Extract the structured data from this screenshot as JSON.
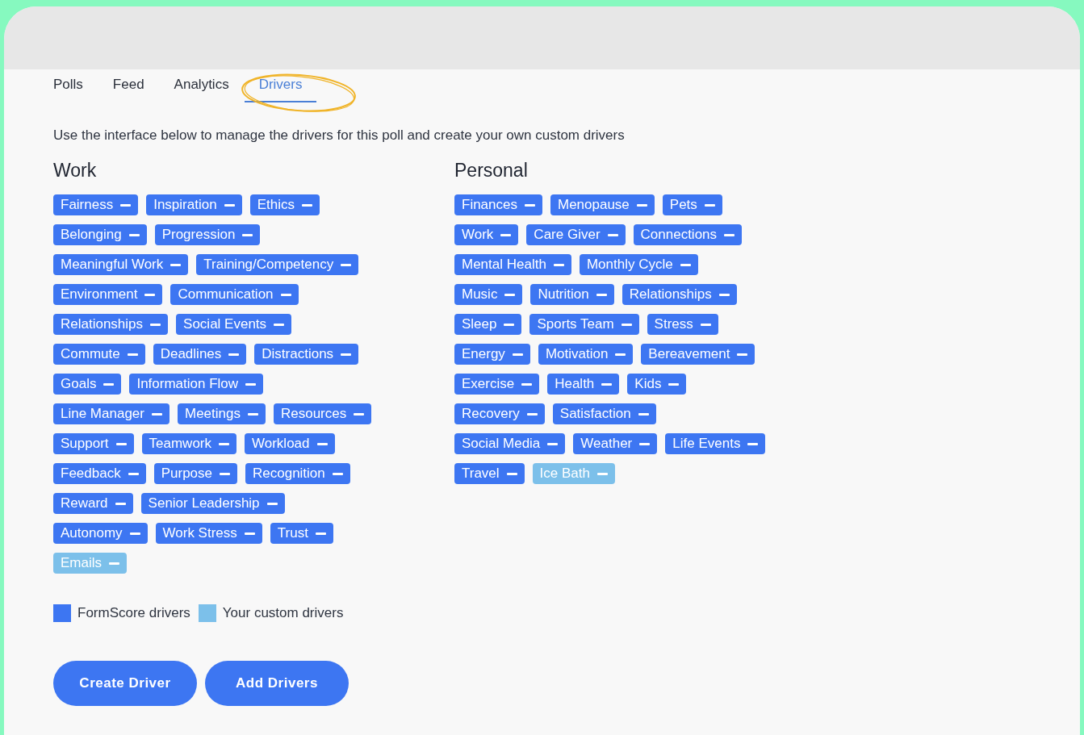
{
  "tabs": [
    {
      "label": "Polls",
      "selected": false,
      "circled": false
    },
    {
      "label": "Feed",
      "selected": false,
      "circled": false
    },
    {
      "label": "Analytics",
      "selected": false,
      "circled": false
    },
    {
      "label": "Drivers",
      "selected": true,
      "circled": true
    }
  ],
  "intro": "Use the interface below to manage the drivers for this poll and create your own custom drivers",
  "groups": [
    {
      "title": "Work",
      "rows": [
        [
          {
            "label": "Fairness",
            "kind": "formscore"
          },
          {
            "label": "Inspiration",
            "kind": "formscore"
          },
          {
            "label": "Ethics",
            "kind": "formscore"
          }
        ],
        [
          {
            "label": "Belonging",
            "kind": "formscore"
          },
          {
            "label": "Progression",
            "kind": "formscore"
          }
        ],
        [
          {
            "label": "Meaningful Work",
            "kind": "formscore"
          },
          {
            "label": "Training/Competency",
            "kind": "formscore"
          }
        ],
        [
          {
            "label": "Environment",
            "kind": "formscore"
          },
          {
            "label": "Communication",
            "kind": "formscore"
          }
        ],
        [
          {
            "label": "Relationships",
            "kind": "formscore"
          },
          {
            "label": "Social Events",
            "kind": "formscore"
          }
        ],
        [
          {
            "label": "Commute",
            "kind": "formscore"
          },
          {
            "label": "Deadlines",
            "kind": "formscore"
          },
          {
            "label": "Distractions",
            "kind": "formscore"
          }
        ],
        [
          {
            "label": "Goals",
            "kind": "formscore"
          },
          {
            "label": "Information Flow",
            "kind": "formscore"
          }
        ],
        [
          {
            "label": "Line Manager",
            "kind": "formscore"
          },
          {
            "label": "Meetings",
            "kind": "formscore"
          },
          {
            "label": "Resources",
            "kind": "formscore"
          }
        ],
        [
          {
            "label": "Support",
            "kind": "formscore"
          },
          {
            "label": "Teamwork",
            "kind": "formscore"
          },
          {
            "label": "Workload",
            "kind": "formscore"
          }
        ],
        [
          {
            "label": "Feedback",
            "kind": "formscore"
          },
          {
            "label": "Purpose",
            "kind": "formscore"
          },
          {
            "label": "Recognition",
            "kind": "formscore"
          }
        ],
        [
          {
            "label": "Reward",
            "kind": "formscore"
          },
          {
            "label": "Senior Leadership",
            "kind": "formscore"
          }
        ],
        [
          {
            "label": "Autonomy",
            "kind": "formscore"
          },
          {
            "label": "Work Stress",
            "kind": "formscore"
          },
          {
            "label": "Trust",
            "kind": "formscore"
          }
        ],
        [
          {
            "label": "Emails",
            "kind": "custom"
          }
        ]
      ]
    },
    {
      "title": "Personal",
      "rows": [
        [
          {
            "label": "Finances",
            "kind": "formscore"
          },
          {
            "label": "Menopause",
            "kind": "formscore"
          },
          {
            "label": "Pets",
            "kind": "formscore"
          }
        ],
        [
          {
            "label": "Work",
            "kind": "formscore"
          },
          {
            "label": "Care Giver",
            "kind": "formscore"
          },
          {
            "label": "Connections",
            "kind": "formscore"
          }
        ],
        [
          {
            "label": "Mental Health",
            "kind": "formscore"
          },
          {
            "label": "Monthly Cycle",
            "kind": "formscore"
          }
        ],
        [
          {
            "label": "Music",
            "kind": "formscore"
          },
          {
            "label": "Nutrition",
            "kind": "formscore"
          },
          {
            "label": "Relationships",
            "kind": "formscore"
          }
        ],
        [
          {
            "label": "Sleep",
            "kind": "formscore"
          },
          {
            "label": "Sports Team",
            "kind": "formscore"
          },
          {
            "label": "Stress",
            "kind": "formscore"
          }
        ],
        [
          {
            "label": "Energy",
            "kind": "formscore"
          },
          {
            "label": "Motivation",
            "kind": "formscore"
          },
          {
            "label": "Bereavement",
            "kind": "formscore"
          }
        ],
        [
          {
            "label": "Exercise",
            "kind": "formscore"
          },
          {
            "label": "Health",
            "kind": "formscore"
          },
          {
            "label": "Kids",
            "kind": "formscore"
          }
        ],
        [
          {
            "label": "Recovery",
            "kind": "formscore"
          },
          {
            "label": "Satisfaction",
            "kind": "formscore"
          }
        ],
        [
          {
            "label": "Social Media",
            "kind": "formscore"
          },
          {
            "label": "Weather",
            "kind": "formscore"
          },
          {
            "label": "Life Events",
            "kind": "formscore"
          }
        ],
        [
          {
            "label": "Travel",
            "kind": "formscore"
          },
          {
            "label": "Ice Bath",
            "kind": "custom"
          }
        ]
      ]
    }
  ],
  "legend": [
    {
      "label": "FormScore drivers",
      "kind": "formscore"
    },
    {
      "label": "Your custom drivers",
      "kind": "custom"
    }
  ],
  "buttons": [
    "Create Driver",
    "Add Drivers"
  ]
}
